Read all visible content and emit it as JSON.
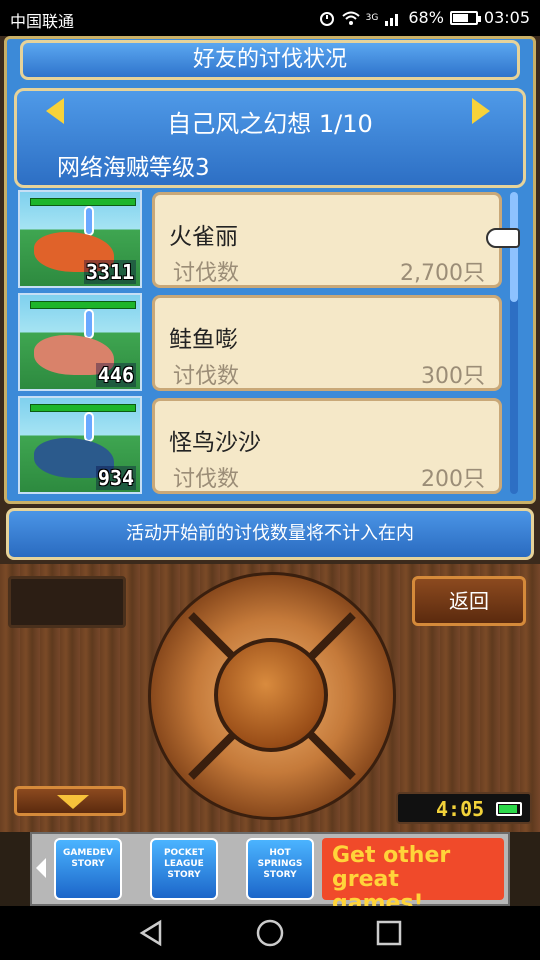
{
  "status_bar": {
    "carrier": "中国联通",
    "network": "3G",
    "battery_percent": "68%",
    "time": "03:05"
  },
  "panel": {
    "title": "好友的讨伐状况",
    "opponent_title": "自己风之幻想 1/10",
    "pirate_level": "网络海贼等级3"
  },
  "monsters": [
    {
      "name": "火雀丽",
      "label": "讨伐数",
      "value": "2,700只",
      "badge": "3311",
      "color": "#e0622a"
    },
    {
      "name": "鲑鱼嘭",
      "label": "讨伐数",
      "value": "300只",
      "badge": "446",
      "color": "#d9826a"
    },
    {
      "name": "怪鸟沙沙",
      "label": "讨伐数",
      "value": "200只",
      "badge": "934",
      "color": "#2b5a8c"
    }
  ],
  "notice": "活动开始前的讨伐数量将不计入在内",
  "controls": {
    "back_label": "返回",
    "game_clock": "4:05"
  },
  "ad": {
    "games": [
      "GAMEDEV STORY",
      "POCKET LEAGUE STORY",
      "HOT SPRINGS STORY"
    ],
    "cta": "Get other great games!"
  }
}
